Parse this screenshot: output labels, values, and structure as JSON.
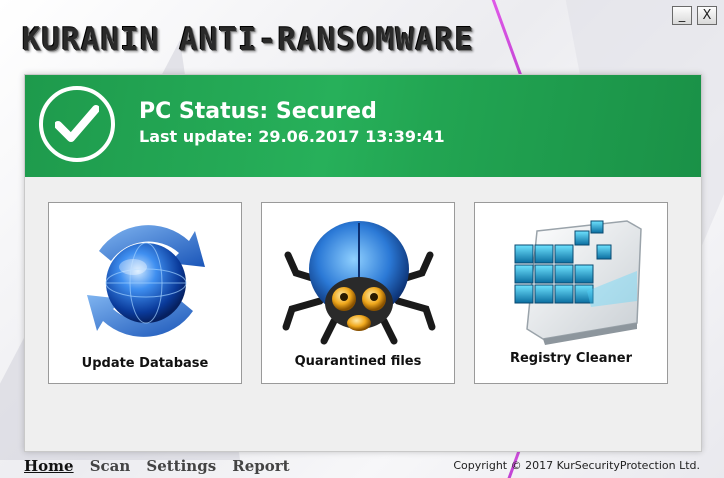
{
  "app": {
    "title": "KURANIN ANTI-RANSOMWARE",
    "minimize_label": "_",
    "close_label": "X"
  },
  "status": {
    "title": "PC Status: Secured",
    "last_update": "Last update: 29.06.2017 13:39:41",
    "color": "#22a552"
  },
  "tiles": [
    {
      "label": "Update Database",
      "icon": "globe-refresh-icon"
    },
    {
      "label": "Quarantined files",
      "icon": "bug-icon"
    },
    {
      "label": "Registry Cleaner",
      "icon": "registry-cubes-icon"
    }
  ],
  "nav": {
    "items": [
      "Home",
      "Scan",
      "Settings",
      "Report"
    ],
    "active": "Home"
  },
  "footer": {
    "copyright": "Copyright © 2017 KurSecurityProtection Ltd."
  }
}
